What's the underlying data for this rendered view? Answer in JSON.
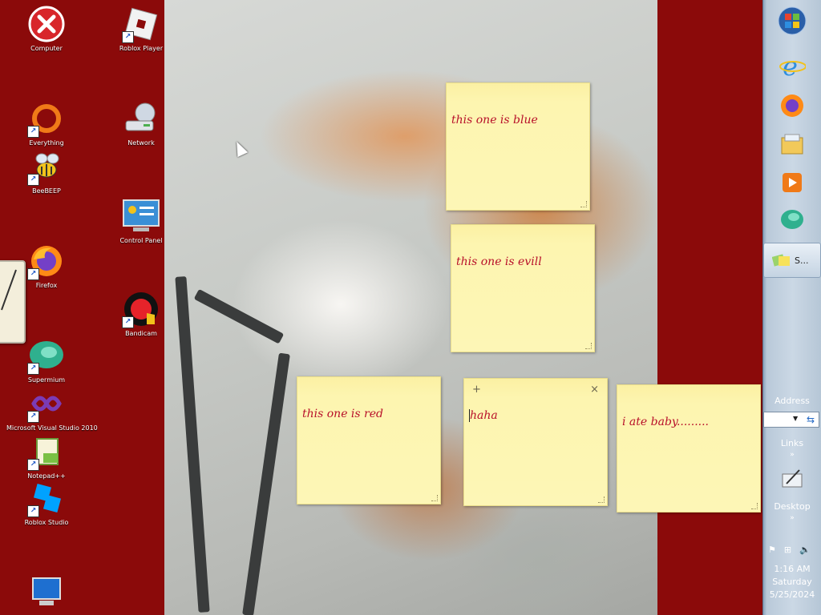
{
  "desktop_icons": [
    {
      "label": "Computer",
      "icon": "red-x-icon"
    },
    {
      "label": "Roblox Player",
      "icon": "roblox-icon"
    },
    {
      "label": "Everything",
      "icon": "everything-icon"
    },
    {
      "label": "Network",
      "icon": "network-icon"
    },
    {
      "label": "BeeBEEP",
      "icon": "bee-icon"
    },
    {
      "label": "Control Panel",
      "icon": "control-panel-icon"
    },
    {
      "label": "Firefox",
      "icon": "firefox-icon"
    },
    {
      "label": "Bandicam",
      "icon": "bandicam-icon"
    },
    {
      "label": "Supermium",
      "icon": "supermium-icon"
    },
    {
      "label": "Microsoft Visual Studio 2010",
      "icon": "visual-studio-icon"
    },
    {
      "label": "Notepad++",
      "icon": "notepad-plus-icon"
    },
    {
      "label": "Roblox Studio",
      "icon": "roblox-studio-icon"
    },
    {
      "label": "",
      "icon": "computer-monitor-icon"
    }
  ],
  "notes": [
    {
      "text": "this one is blue"
    },
    {
      "text": "this one is evill"
    },
    {
      "text": "this one is red"
    },
    {
      "text": "haha",
      "add_glyph": "+",
      "close_glyph": "×"
    },
    {
      "text": "i ate baby........."
    }
  ],
  "taskbar": {
    "active_button_label": "S...",
    "address_label": "Address",
    "links_label": "Links",
    "desktop_label": "Desktop",
    "chevron": "»",
    "time": "1:16 AM",
    "day": "Saturday",
    "date": "5/25/2024"
  },
  "colors": {
    "desktop_background": "#8b0a0a",
    "note_yellow": "#fdf6b6",
    "note_text": "#b8102a"
  }
}
